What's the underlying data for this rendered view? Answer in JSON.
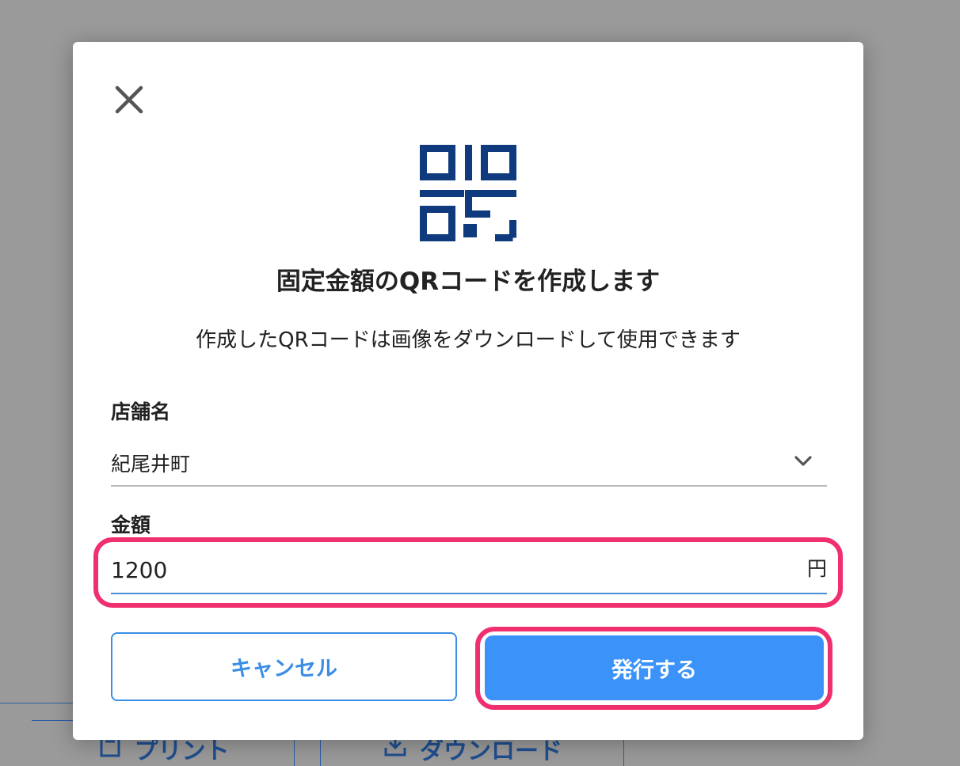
{
  "background": {
    "print_label": "プリント",
    "download_label": "ダウンロード"
  },
  "modal": {
    "close_icon": "close-icon",
    "qr_icon": "qr-code-icon",
    "title": "固定金額のQRコードを作成します",
    "description": "作成したQRコードは画像をダウンロードして使用できます",
    "store": {
      "label": "店舗名",
      "value": "紀尾井町"
    },
    "amount": {
      "label": "金額",
      "value": "1200",
      "unit": "円"
    },
    "cancel_label": "キャンセル",
    "issue_label": "発行する"
  },
  "colors": {
    "primary": "#3b93fa",
    "highlight": "#f0306e",
    "icon_navy": "#0f3a7d",
    "overlay": "#9a9a9a"
  }
}
